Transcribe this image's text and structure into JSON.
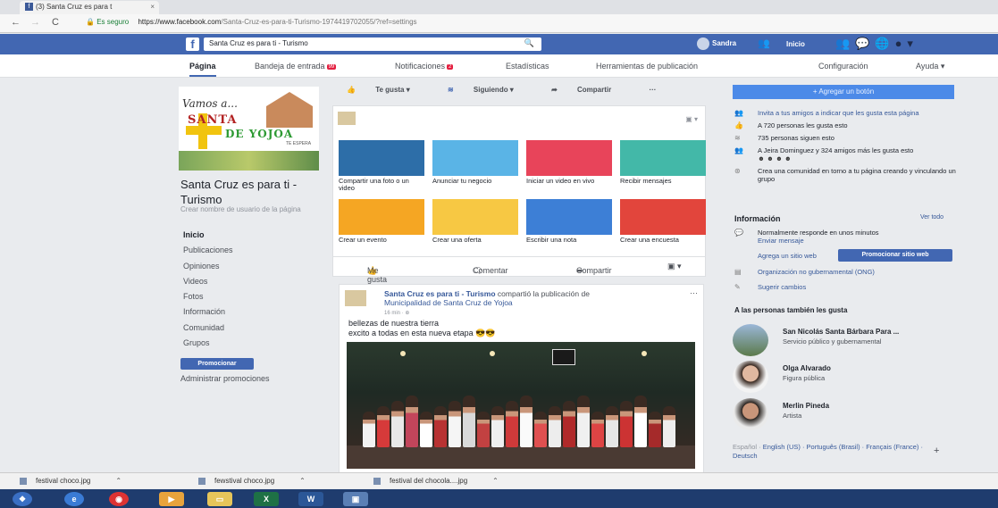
{
  "browser": {
    "tab_title": "(3) Santa Cruz es para t",
    "tab_close": "×",
    "secure_label": "Es seguro",
    "url_host": "https://www.facebook.com",
    "url_path": "/Santa-Cruz-es-para-ti-Turismo-1974419702055/?ref=settings"
  },
  "fb": {
    "logo": "f",
    "search_value": "Santa Cruz es para ti - Turismo",
    "user_name": "Sandra",
    "home_label": "Inicio"
  },
  "page_tabs": [
    {
      "label": "Página"
    },
    {
      "label": "Bandeja de entrada",
      "badge": "99"
    },
    {
      "label": "Notificaciones",
      "badge": "2"
    },
    {
      "label": "Estadísticas"
    },
    {
      "label": "Herramientas de publicación"
    },
    {
      "label": "Configuración"
    },
    {
      "label": "Ayuda ▾"
    }
  ],
  "cover": {
    "line1": "Vamos a...",
    "line2": "SANTA",
    "line3": "DE YOJOA",
    "slogan": "TE ESPERA"
  },
  "page": {
    "name": "Santa Cruz es para ti - Turismo",
    "username_prompt": "Crear nombre de usuario de la página"
  },
  "left_nav": [
    "Inicio",
    "Publicaciones",
    "Opiniones",
    "Videos",
    "Fotos",
    "Información",
    "Comunidad",
    "Grupos"
  ],
  "promote_label": "Promocionar",
  "admin_promos_label": "Administrar promociones",
  "actions": {
    "like": "Te gusta ▾",
    "following": "Siguiendo ▾",
    "share": "Compartir",
    "more": "···"
  },
  "composer": {
    "tiles": [
      {
        "label": "Compartir una foto o un video",
        "color": "#2d6ea8"
      },
      {
        "label": "Anunciar tu negocio",
        "color": "#5ab4e6"
      },
      {
        "label": "Iniciar un video en vivo",
        "color": "#e8445a"
      },
      {
        "label": "Recibir mensajes",
        "color": "#43b8a8"
      },
      {
        "label": "Crear un evento",
        "color": "#f5a623"
      },
      {
        "label": "Crear una oferta",
        "color": "#f7c843"
      },
      {
        "label": "Escribir una nota",
        "color": "#3d7fd6"
      },
      {
        "label": "Crear una encuesta",
        "color": "#e2453c"
      }
    ],
    "reactions": {
      "like": "Me gusta",
      "comment": "Comentar",
      "share": "Compartir"
    }
  },
  "post": {
    "author": "Santa Cruz es para ti - Turismo",
    "action": "compartió la publicación de",
    "source": "Municipalidad de Santa Cruz de Yojoa",
    "time": "16 min",
    "text_line1": "bellezas de nuestra tierra",
    "text_line2": "excito a todas en esta nueva etapa 😎😎"
  },
  "right": {
    "add_button": "+ Agregar un botón",
    "items": [
      "Invita a tus amigos a indicar que les gusta esta página",
      "A 720 personas les gusta esto",
      "735 personas siguen esto",
      "A Jeira Dominguez y 324 amigos más les gusta esto",
      "Crea una comunidad en torno a tu página creando y vinculando un grupo"
    ],
    "info_title": "Información",
    "see_all": "Ver todo",
    "response": "Normalmente responde en unos minutos",
    "send_message": "Enviar mensaje",
    "add_website": "Agrega un sitio web",
    "promote_website": "Promocionar sitio web",
    "category": "Organización no gubernamental (ONG)",
    "suggest": "Sugerir cambios",
    "also_like_title": "A las personas también les gusta",
    "also_like": [
      {
        "name": "San Nicolás Santa Bárbara Para ...",
        "category": "Servicio público y gubernamental"
      },
      {
        "name": "Olga Alvarado",
        "category": "Figura pública"
      },
      {
        "name": "Merlin Pineda",
        "category": "Artista"
      }
    ],
    "languages_prefix": "Español",
    "languages": "English (US) · Português (Brasil) · Français (France) · Deutsch"
  },
  "downloads": [
    "festival choco.jpg",
    "fewstival choco.jpg",
    "festival del chocola....jpg"
  ]
}
